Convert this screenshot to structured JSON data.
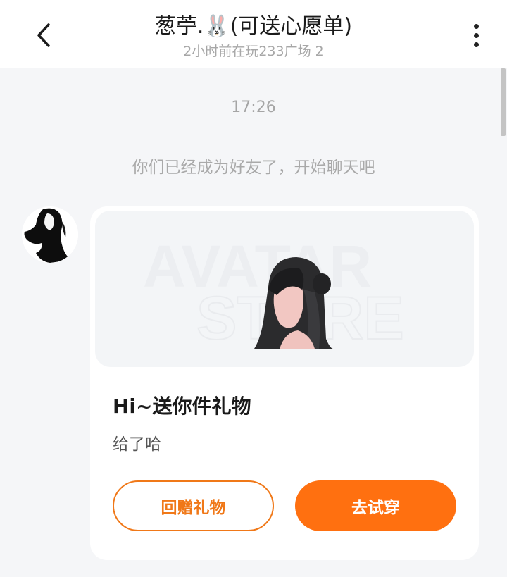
{
  "header": {
    "title": "葱苧.🐰(可送心愿单)",
    "subtitle": "2小时前在玩233广场 2",
    "back_icon": "chevron-left-icon",
    "more_icon": "more-vertical-icon"
  },
  "chat": {
    "timestamp": "17:26",
    "system_message": "你们已经成为好友了，开始聊天吧"
  },
  "gift_card": {
    "watermark_line1": "AVATAR",
    "watermark_line2": "STORE",
    "title": "Hi~送你件礼物",
    "description": "给了哈",
    "return_gift_label": "回赠礼物",
    "try_on_label": "去试穿"
  },
  "colors": {
    "accent": "#ff7010",
    "accent_outline": "#f07818",
    "background": "#f5f6f8"
  }
}
